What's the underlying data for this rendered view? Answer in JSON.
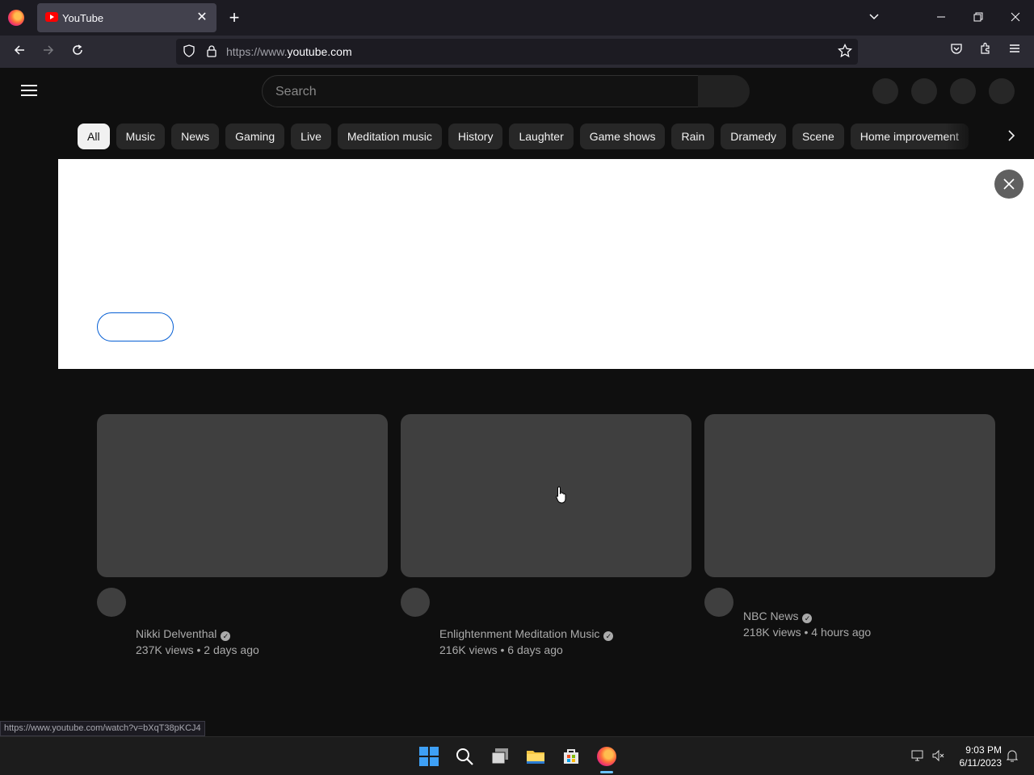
{
  "browser": {
    "tab_title": "YouTube",
    "tab_close": "✕",
    "new_tab": "+",
    "url_dim": "https://www.",
    "url_main": "youtube.com",
    "status_link": "https://www.youtube.com/watch?v=bXqT38pKCJ4"
  },
  "youtube": {
    "search_placeholder": "Search",
    "chips": [
      "All",
      "Music",
      "News",
      "Gaming",
      "Live",
      "Meditation music",
      "History",
      "Laughter",
      "Game shows",
      "Rain",
      "Dramedy",
      "Scene",
      "Home improvement"
    ],
    "videos": [
      {
        "channel": "Nikki Delventhal",
        "meta": "237K views • 2 days ago"
      },
      {
        "channel": "Enlightenment Meditation Music",
        "meta": "216K views • 6 days ago"
      },
      {
        "channel": "NBC News",
        "meta": "218K views • 4 hours ago"
      }
    ]
  },
  "taskbar": {
    "time": "9:03 PM",
    "date": "6/11/2023"
  },
  "colors": {
    "yt_bg": "#0f0f0f",
    "chip_active": "#f1f1f1",
    "banner_bg": "#ffffff",
    "accent_blue": "#065fd4"
  }
}
